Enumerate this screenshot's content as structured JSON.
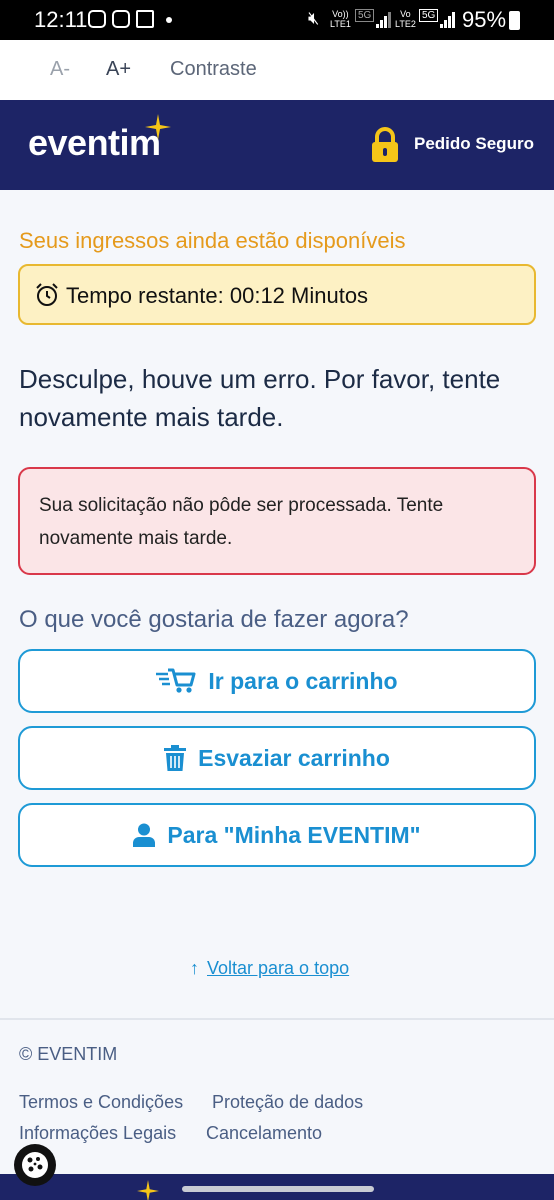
{
  "status_bar": {
    "time": "12:11",
    "net1": "Vo))\nLTE1",
    "net2": "Vo\nLTE2",
    "g5a": "5G",
    "g5b": "5G",
    "battery": "95%"
  },
  "a11y": {
    "decrease": "A-",
    "increase": "A+",
    "contrast": "Contraste"
  },
  "header": {
    "logo": "eventim",
    "secure_label": "Pedido Seguro"
  },
  "main": {
    "availability": "Seus ingressos ainda estão disponíveis",
    "timer_text": "Tempo restante: 00:12 Minutos",
    "error_title": "Desculpe, houve um erro. Por favor, tente novamente mais tarde.",
    "alert_text": "Sua solicitação não pôde ser processada. Tente novamente mais tarde.",
    "question": "O que você gostaria de fazer agora?",
    "buttons": [
      {
        "label": "Ir para o carrinho",
        "icon": "fast-cart-icon"
      },
      {
        "label": "Esvaziar carrinho",
        "icon": "trash-icon"
      },
      {
        "label": "Para \"Minha EVENTIM\"",
        "icon": "user-icon"
      }
    ],
    "back_to_top": "Voltar para o topo"
  },
  "footer": {
    "copyright": "© EVENTIM",
    "links": [
      "Termos e Condições",
      "Proteção de dados",
      "Informações Legais",
      "Cancelamento"
    ]
  },
  "colors": {
    "brand_navy": "#1d2466",
    "accent_blue": "#1a8fd1",
    "warning_orange": "#e59a1c",
    "error_red": "#d9384a",
    "star_gold": "#f5c518"
  }
}
